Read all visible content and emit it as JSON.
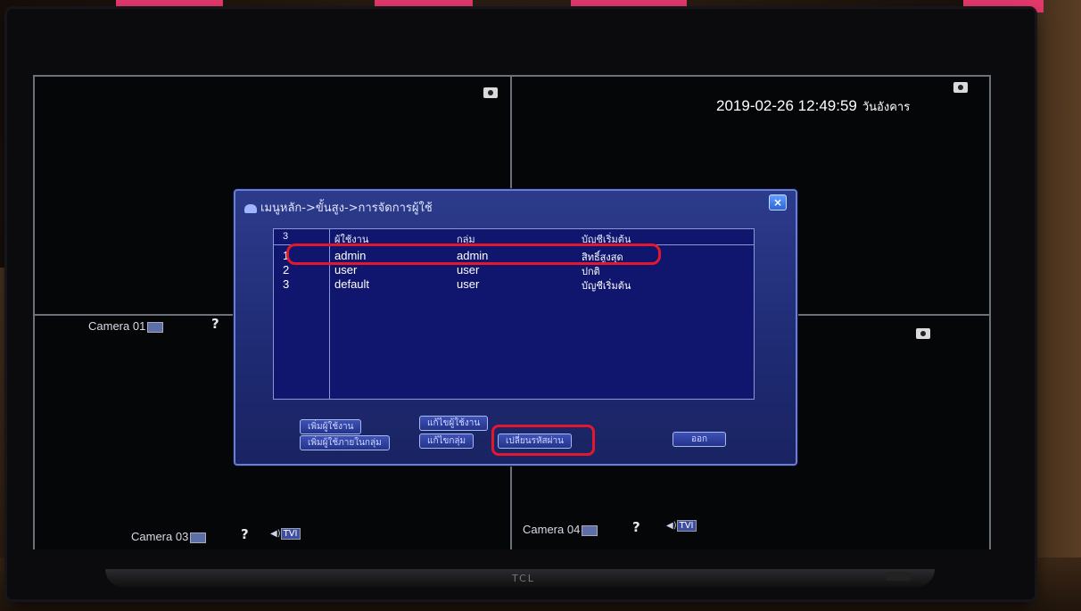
{
  "camera_labels": {
    "cam1": "Camera 01",
    "cam3": "Camera 03",
    "cam4": "Camera 04"
  },
  "tvi_label": "TVI",
  "question_mark": "?",
  "datetime": {
    "text": "2019-02-26 12:49:59",
    "day": "วันอังคาร"
  },
  "dialog": {
    "title": "เมนูหลัก->ขั้นสูง->การจัดการผู้ใช้",
    "close_label": "×",
    "columns": [
      "3",
      "ผู้ใช้งาน",
      "กลุ่ม",
      "บัญชีเริ่มต้น"
    ],
    "rows": [
      {
        "no": "1",
        "user": "admin",
        "group": "admin",
        "account": "สิทธิ์สูงสุด"
      },
      {
        "no": "2",
        "user": "user",
        "group": "user",
        "account": "ปกติ"
      },
      {
        "no": "3",
        "user": "default",
        "group": "user",
        "account": "บัญชีเริ่มต้น"
      }
    ],
    "buttons": {
      "add_user": "เพิ่มผู้ใช้งาน",
      "edit_user": "แก้ไขผู้ใช้งาน",
      "add_group": "เพิ่มผู้ใช้ภายในกลุ่ม",
      "edit_group": "แก้ไขกลุ่ม",
      "change_password": "เปลี่ยนรหัสผ่าน",
      "exit": "ออก"
    }
  },
  "brand": "TCL",
  "colors": {
    "highlight": "#e3182c",
    "dialog_bg": "#1e2a72",
    "watermark": "#e6396e"
  }
}
